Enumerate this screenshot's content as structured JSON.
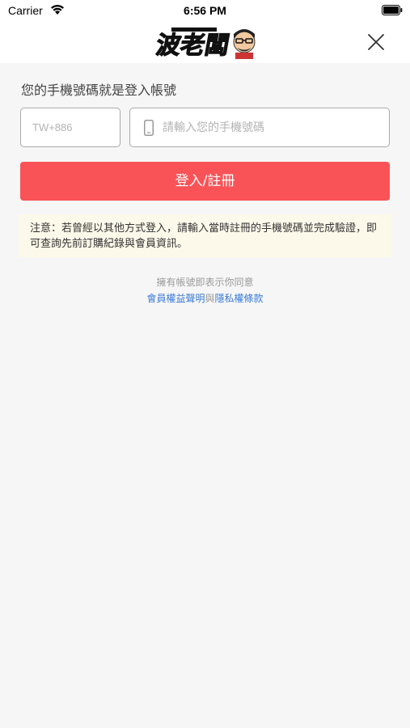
{
  "status_bar": {
    "carrier": "Carrier",
    "time": "6:56 PM"
  },
  "header": {
    "logo_text": "波老闆"
  },
  "login": {
    "prompt": "您的手機號碼就是登入帳號",
    "country_code": "TW+886",
    "phone_placeholder": "請輸入您的手機號碼",
    "phone_value": "",
    "submit_label": "登入/註冊"
  },
  "notice": {
    "text": "注意：若曾經以其他方式登入，請輸入當時註冊的手機號碼並完成驗證，即可查詢先前訂購紀錄與會員資訊。"
  },
  "agreement": {
    "text": "擁有帳號即表示你同意",
    "terms_link": "會員權益聲明",
    "conjunction": "與",
    "privacy_link": "隱私權條款"
  },
  "colors": {
    "accent": "#f95357",
    "link": "#3a7ad8",
    "notice_bg": "#fdf9ea",
    "page_bg": "#f6f6f6"
  },
  "icons": [
    "wifi-icon",
    "battery-icon",
    "close-icon",
    "phone-icon"
  ]
}
